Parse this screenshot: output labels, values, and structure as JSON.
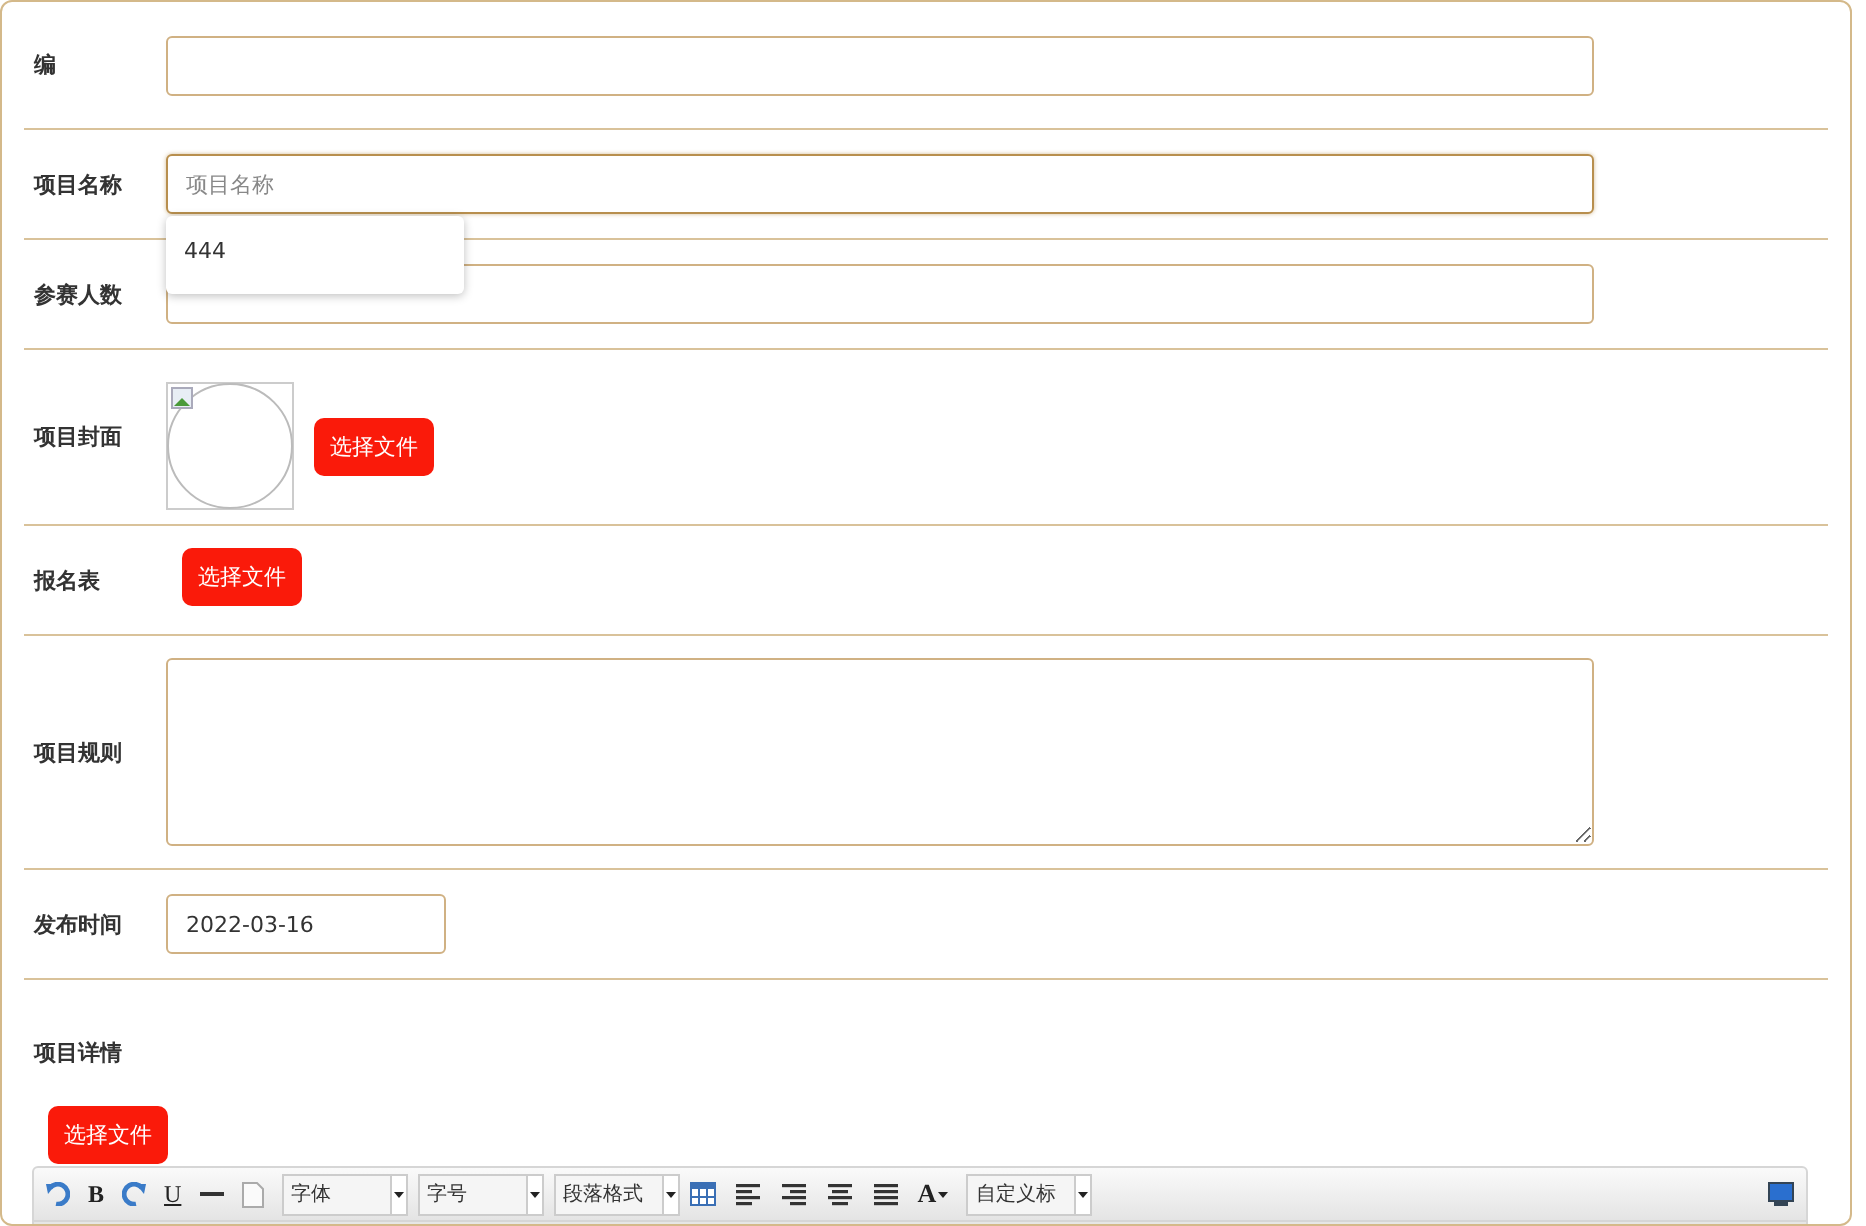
{
  "rows": [
    {
      "kind": "text",
      "label": "编"
    },
    {
      "kind": "text",
      "label": "项目名称",
      "placeholder": "项目名称",
      "focused": true,
      "suggestions": [
        "444"
      ]
    },
    {
      "kind": "text",
      "label": "参赛人数"
    },
    {
      "kind": "image",
      "label": "项目封面",
      "button": "选择文件"
    },
    {
      "kind": "file",
      "label": "报名表",
      "button": "选择文件"
    },
    {
      "kind": "textarea",
      "label": "项目规则"
    },
    {
      "kind": "date",
      "label": "发布时间",
      "value": "2022-03-16"
    }
  ],
  "details": {
    "label": "项目详情",
    "button": "选择文件",
    "toolbar": [
      {
        "kind": "undo"
      },
      {
        "kind": "bold",
        "text": "B"
      },
      {
        "kind": "redo"
      },
      {
        "kind": "underline",
        "text": "U"
      },
      {
        "kind": "hr"
      },
      {
        "kind": "page"
      },
      {
        "kind": "select",
        "text": "字体"
      },
      {
        "kind": "select",
        "text": "字号"
      },
      {
        "kind": "select",
        "text": "段落格式"
      },
      {
        "kind": "table"
      },
      {
        "kind": "align-left"
      },
      {
        "kind": "align-right"
      },
      {
        "kind": "align-center"
      },
      {
        "kind": "justify"
      },
      {
        "kind": "color",
        "text": "A"
      },
      {
        "kind": "select",
        "text": "自定义标"
      },
      {
        "kind": "spacer"
      },
      {
        "kind": "preview"
      }
    ]
  }
}
